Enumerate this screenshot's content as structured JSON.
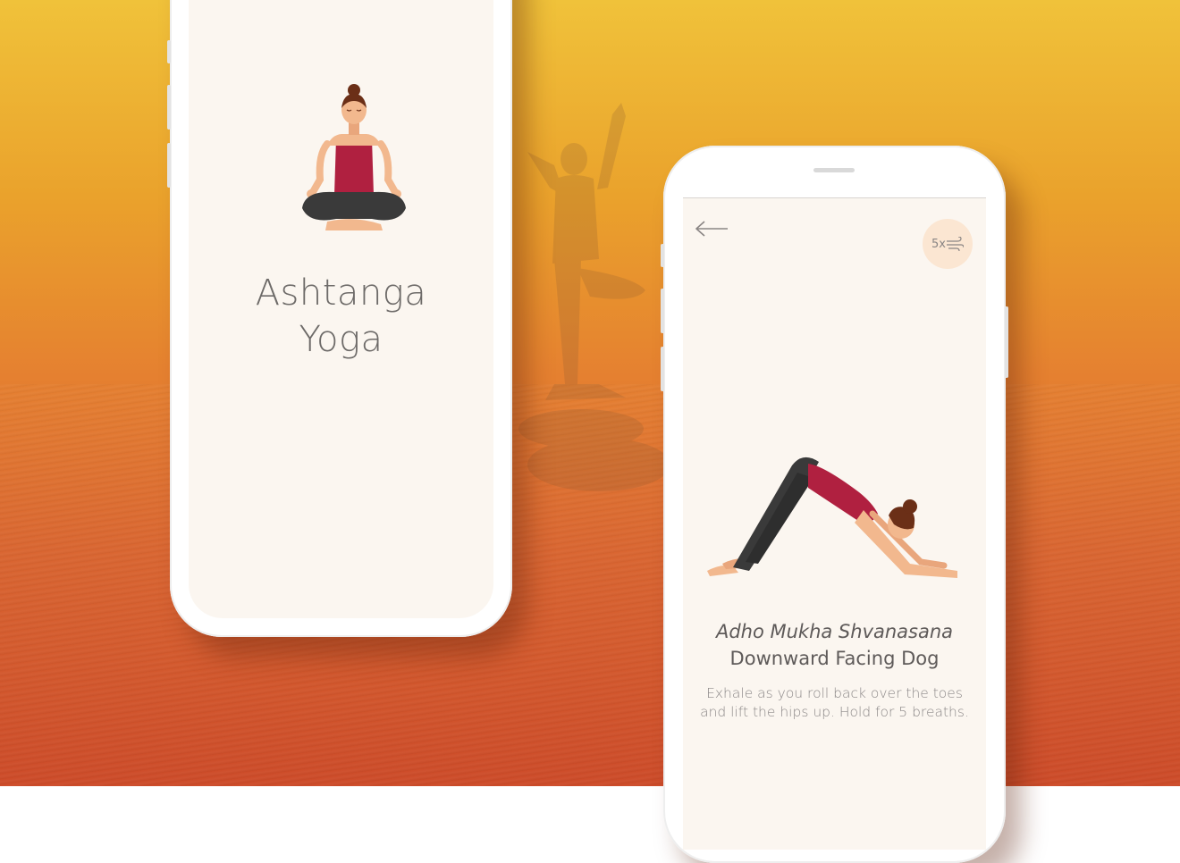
{
  "splash": {
    "title_line1": "Ashtanga",
    "title_line2": "Yoga",
    "illustration_icon": "meditating-woman-icon"
  },
  "pose_screen": {
    "back_icon": "back-arrow-icon",
    "breath_count": "5x",
    "breath_icon": "wind-breath-icon",
    "illustration_icon": "downward-dog-woman-icon",
    "sanskrit_name": "Adho Mukha Shvanasana",
    "english_name": "Downward Facing Dog",
    "description": "Exhale as you roll back over the toes and lift the hips up. Hold for 5 breaths."
  },
  "colors": {
    "background_top": "#f0c23a",
    "background_bottom": "#cc4a28",
    "screen": "#fbf6f0",
    "top_garment": "#b02040",
    "leggings": "#3a3a3a",
    "skin": "#f2b88e",
    "hair": "#6b2f17",
    "badge": "#fbe6d2"
  }
}
